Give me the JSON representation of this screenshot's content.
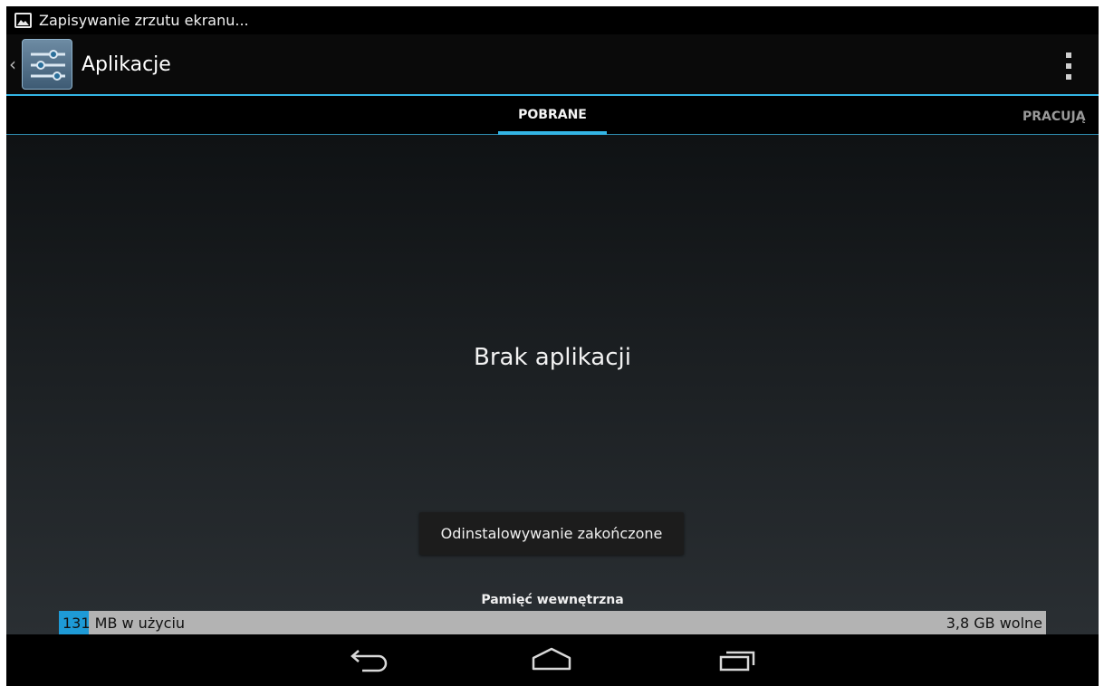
{
  "status_bar": {
    "notification_text": "Zapisywanie zrzutu ekranu...",
    "icon": "screenshot-image-icon"
  },
  "action_bar": {
    "title": "Aplikacje",
    "icon": "settings-sliders-icon",
    "up_icon": "up-caret-icon",
    "overflow_icon": "overflow-menu-icon",
    "accent_color": "#33b5e5"
  },
  "tabs": [
    {
      "label": "POBRANE",
      "selected": true
    },
    {
      "label": "PRACUJĄ",
      "selected": false
    }
  ],
  "content": {
    "empty_message": "Brak aplikacji"
  },
  "toast": {
    "message": "Odinstalowywanie zakończone"
  },
  "storage": {
    "label": "Pamięć wewnętrzna",
    "used_value": "131",
    "used_suffix": " MB w użyciu",
    "free_text": "3,8 GB wolne",
    "used_fraction": 0.03,
    "used_color": "#1e9ad6",
    "bar_color": "#b3b3b3"
  },
  "nav_bar": {
    "back_icon": "back-arrow-icon",
    "home_icon": "home-icon",
    "recent_icon": "recent-apps-icon"
  }
}
